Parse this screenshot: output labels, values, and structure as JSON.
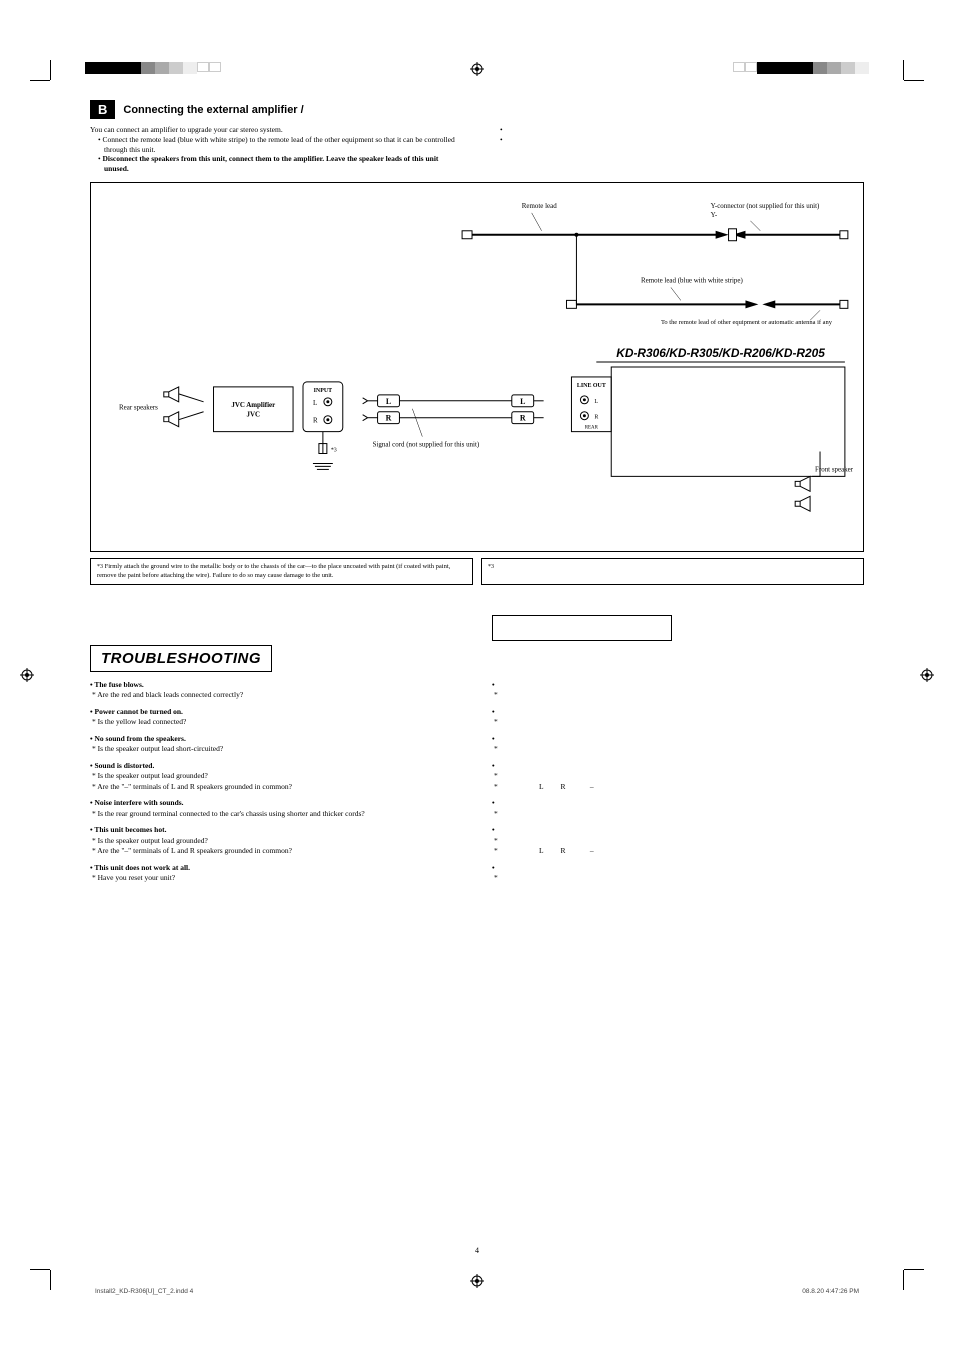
{
  "section": {
    "letter": "B",
    "title": "Connecting the external amplifier /"
  },
  "intro": {
    "left": {
      "p1": "You can connect an amplifier to upgrade your car stereo system.",
      "b1": "Connect the remote lead (blue with white stripe) to the remote lead of the other equipment so that it can be controlled through this unit.",
      "b2": "Disconnect the speakers from this unit, connect them to the amplifier. Leave the speaker leads of this unit unused."
    }
  },
  "diagram": {
    "remote_lead": "Remote lead",
    "y_connector": "Y-connector (not supplied for this unit)",
    "y_suffix": "Y-",
    "remote_lead_blue": "Remote lead (blue with white stripe)",
    "to_remote": "To the remote lead of other equipment or automatic antenna if any",
    "model": "KD-R306/KD-R305/KD-R206/KD-R205",
    "rear_speakers": "Rear speakers",
    "jvc_amp": "JVC Amplifier",
    "jvc": "JVC",
    "input": "INPUT",
    "signal_cord": "Signal cord (not supplied for this unit)",
    "line_out": "LINE OUT",
    "rear": "REAR",
    "front_speakers": "Front speakers",
    "star3": "*3",
    "L": "L",
    "R": "R"
  },
  "note": {
    "star3": "*3",
    "text": "Firmly attach the ground wire to the metallic body or to the chassis of the car—to the place uncoated with paint (if coated with paint, remove the paint before attaching the wire). Failure to do so may cause damage to the unit."
  },
  "ts": {
    "title": "TROUBLESHOOTING",
    "items": [
      {
        "q": "The fuse blows.",
        "a": "Are the red and black leads connected correctly?"
      },
      {
        "q": "Power cannot be turned on.",
        "a": "Is the yellow lead connected?"
      },
      {
        "q": "No sound from the speakers.",
        "a": "Is the speaker output lead short-circuited?"
      },
      {
        "q": "Sound is distorted.",
        "a1": "Is the speaker output lead grounded?",
        "a2": "Are the \"–\" terminals of L and R speakers grounded in common?"
      },
      {
        "q": "Noise interfere with sounds.",
        "a": "Is the rear ground terminal connected to the car's chassis using shorter and thicker cords?"
      },
      {
        "q": "This unit becomes hot.",
        "a1": "Is the speaker output lead grounded?",
        "a2": "Are the \"–\" terminals of L and R speakers grounded in common?"
      },
      {
        "q": "This unit does not work at all.",
        "a": "Have you reset your unit?"
      }
    ],
    "right": {
      "L": "L",
      "R": "R",
      "dash": "–"
    }
  },
  "footer": {
    "left": "Install2_KD-R306[U]_CT_2.indd   4",
    "right": "08.8.20   4:47:26 PM",
    "page": "4"
  }
}
